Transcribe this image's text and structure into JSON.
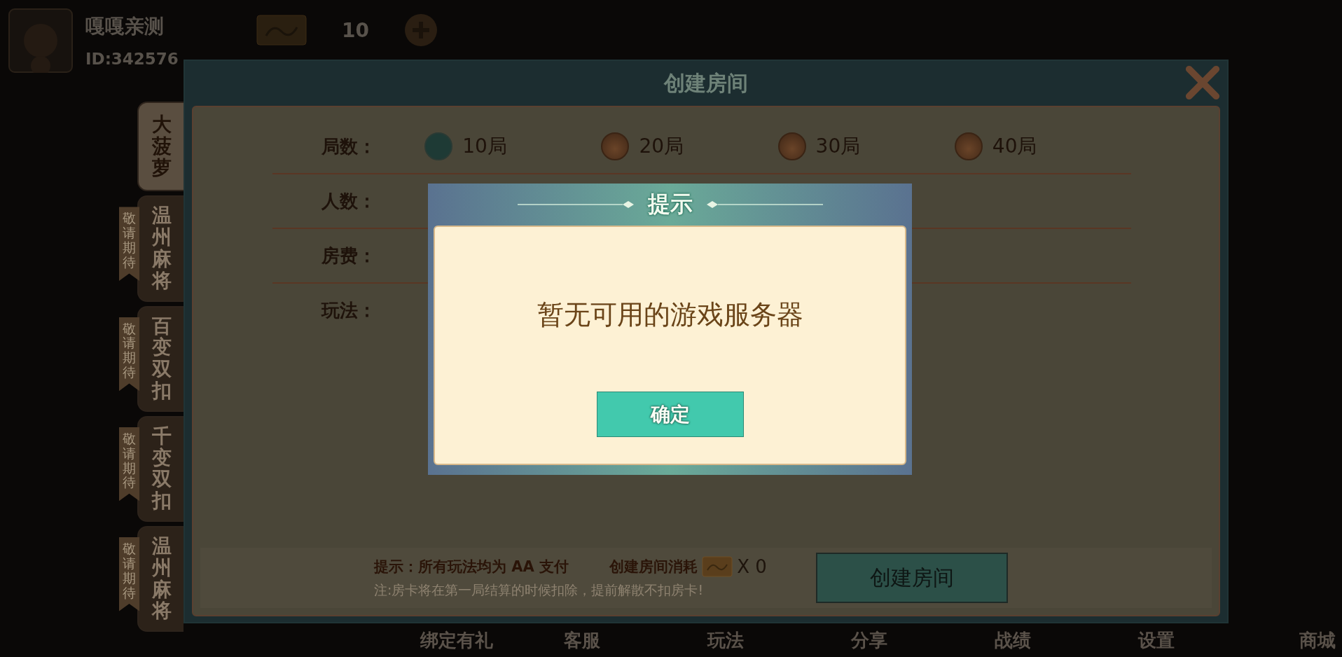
{
  "profile": {
    "name": "嘎嘎亲测",
    "id": "ID:342576"
  },
  "currency": {
    "amount": "10"
  },
  "dialog": {
    "title": "创建房间"
  },
  "game_tabs": [
    {
      "label": "大菠萝",
      "selected": true
    },
    {
      "label": "温州麻将",
      "selected": false,
      "ribbon": "敬请期待"
    },
    {
      "label": "百变双扣",
      "selected": false,
      "ribbon": "敬请期待"
    },
    {
      "label": "千变双扣",
      "selected": false,
      "ribbon": "敬请期待"
    },
    {
      "label": "温州麻将",
      "selected": false,
      "ribbon": "敬请期待"
    }
  ],
  "options": [
    {
      "label": "局数：",
      "choices": [
        {
          "label": "10局",
          "selected": true
        },
        {
          "label": "20局",
          "selected": false
        },
        {
          "label": "30局",
          "selected": false
        },
        {
          "label": "40局",
          "selected": false
        }
      ]
    },
    {
      "label": "人数："
    },
    {
      "label": "房费："
    },
    {
      "label": "玩法："
    }
  ],
  "footer": {
    "tip": "提示：所有玩法均为 AA 支付",
    "cost_label": "创建房间消耗",
    "cost": "X 0",
    "note": "注:房卡将在第一局结算的时候扣除，提前解散不扣房卡!",
    "button": "创建房间"
  },
  "prompt": {
    "title": "提示",
    "message": "暂无可用的游戏服务器",
    "button": "确定"
  },
  "bottom_nav": [
    "绑定有礼",
    "客服",
    "玩法",
    "分享",
    "战绩",
    "设置",
    "商城"
  ]
}
